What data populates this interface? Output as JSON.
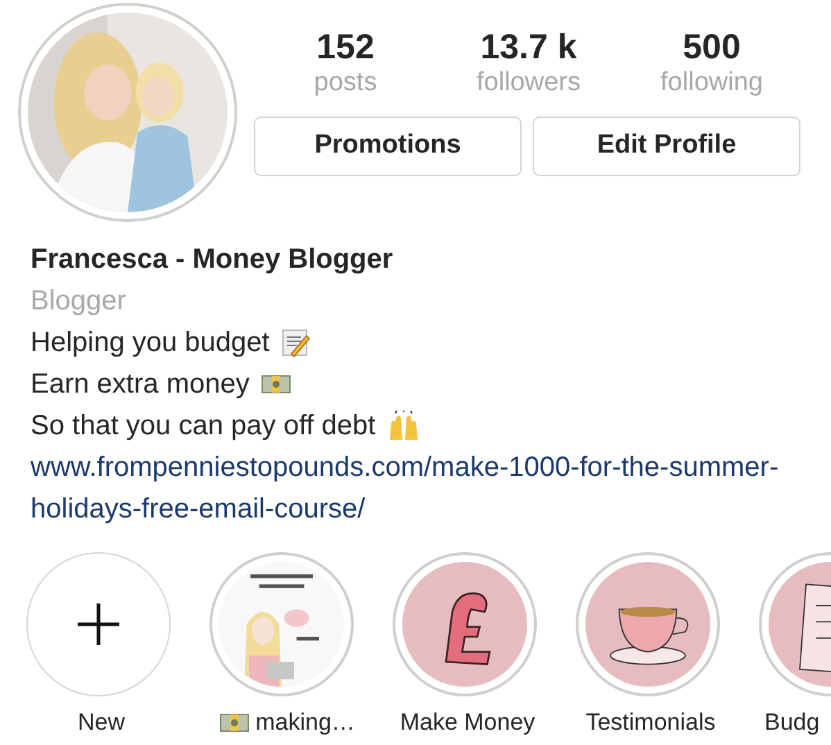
{
  "profile": {
    "stats": [
      {
        "value": "152",
        "label": "posts"
      },
      {
        "value": "13.7 k",
        "label": "followers"
      },
      {
        "value": "500",
        "label": "following"
      }
    ],
    "buttons": [
      "Promotions",
      "Edit Profile"
    ],
    "name": "Francesca - Money Blogger",
    "category": "Blogger",
    "bio": [
      {
        "text": "Helping you budget"
      },
      {
        "text": "Earn extra money"
      },
      {
        "text": "So that you can pay off debt"
      }
    ],
    "link": "www.frompenniestopounds.com/make-1000-for-the-summer-holidays-free-email-course/"
  },
  "highlights": [
    {
      "kind": "new",
      "label": "New"
    },
    {
      "kind": "picture",
      "label": "making…"
    },
    {
      "kind": "picture",
      "label": "Make Money"
    },
    {
      "kind": "picture",
      "label": "Testimonials"
    },
    {
      "kind": "picture",
      "label": "Budg"
    }
  ]
}
